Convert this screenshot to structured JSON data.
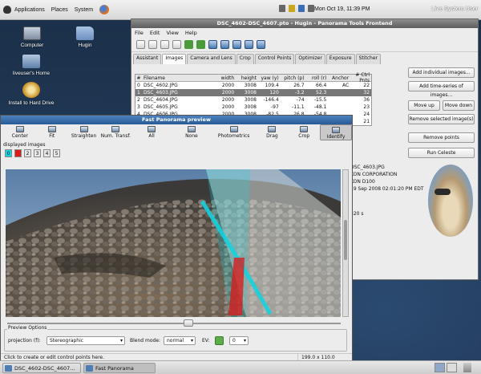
{
  "top_panel": {
    "menus": [
      "Applications",
      "Places",
      "System"
    ],
    "clock": "Mon Oct 19, 11:39 PM",
    "session_user": "Live System User"
  },
  "desktop_icons": [
    {
      "label": "Computer",
      "icon": "computer-icon"
    },
    {
      "label": "Hugin",
      "icon": "folder-icon"
    },
    {
      "label": "liveuser's Home",
      "icon": "home-folder-icon"
    },
    {
      "label": "Install to Hard Drive",
      "icon": "install-icon"
    }
  ],
  "hugin": {
    "title": "DSC_4602-DSC_4607.pto - Hugin - Panorama Tools Frontend",
    "menus": [
      "File",
      "Edit",
      "View",
      "Help"
    ],
    "tabs": [
      "Assistant",
      "Images",
      "Camera and Lens",
      "Crop",
      "Control Points",
      "Optimizer",
      "Exposure",
      "Stitcher"
    ],
    "active_tab": "Images",
    "table": {
      "headers": [
        "#",
        "Filename",
        "width",
        "height",
        "yaw (y)",
        "pitch (p)",
        "roll (r)",
        "Anchor",
        "# Ctrl Pnts"
      ],
      "rows": [
        [
          "0",
          "DSC_4602.JPG",
          "2000",
          "3008",
          "109.4",
          "26.7",
          "66.4",
          "AC",
          "22"
        ],
        [
          "1",
          "DSC_4603.JPG",
          "2000",
          "3008",
          "120",
          "-3.2",
          "52.3",
          "",
          "32"
        ],
        [
          "2",
          "DSC_4604.JPG",
          "2000",
          "3008",
          "-146.4",
          "-74",
          "-15.5",
          "",
          "36"
        ],
        [
          "3",
          "DSC_4605.JPG",
          "2000",
          "3008",
          "-97",
          "-11.1",
          "-48.1",
          "",
          "23"
        ],
        [
          "4",
          "DSC_4606.JPG",
          "2000",
          "3008",
          "-82.5",
          "26.8",
          "-54.8",
          "",
          "24"
        ],
        [
          "5",
          "DSC_4607.JPG",
          "2000",
          "3008",
          "15.7",
          "25.7",
          "57.7",
          "",
          "21"
        ]
      ],
      "selected_row": 1
    },
    "buttons": {
      "add_individual": "Add individual images...",
      "add_series": "Add time-series of images...",
      "move_up": "Move up",
      "move_down": "Move down",
      "remove_selected": "Remove selected image(s)",
      "remove_points": "Remove points",
      "run_celeste": "Run Celeste"
    },
    "info": {
      "file": "DSC_4603.JPG",
      "maker": "KON CORPORATION",
      "model": "KON D100",
      "date": "19 Sep 2008 02:01:20 PM EDT",
      "exposure": "320 s"
    }
  },
  "preview": {
    "title": "Fast Panorama preview",
    "tools": [
      "Center",
      "Fit",
      "Straighten",
      "Num. Transf.",
      "All",
      "None",
      "Photometrics",
      "Drag",
      "Crop",
      "Identify"
    ],
    "active_tool": "Identify",
    "displayed_label": "displayed images",
    "image_buttons": [
      "0",
      "1",
      "2",
      "3",
      "4",
      "5"
    ],
    "options_title": "Preview Options",
    "projection_label": "projection (f):",
    "projection_value": "Stereographic",
    "blend_label": "Blend mode:",
    "blend_value": "normal",
    "ev_label": "EV:",
    "ev_value": "0",
    "status_left": "Click to create or edit control points here.",
    "status_right": "199.0 x 110.0"
  },
  "taskbar": {
    "items": [
      "DSC_4602-DSC_4607...",
      "Fast Panorama preview"
    ]
  },
  "colors": {
    "highlight_cyan": "#13d3df",
    "highlight_red": "#d71d1d",
    "selected_row": "#777777"
  }
}
